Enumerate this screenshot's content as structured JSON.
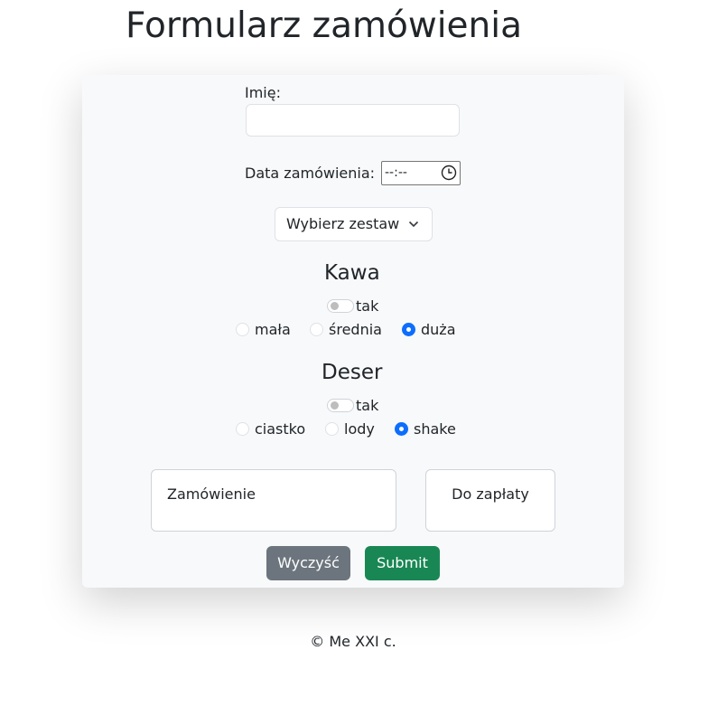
{
  "page": {
    "title": "Formularz zamówienia"
  },
  "form": {
    "name_label": "Imię:",
    "name_value": "",
    "date_label": "Data zamówienia:",
    "time_placeholder": "--:--",
    "set_select": "Wybierz zestaw",
    "coffee": {
      "title": "Kawa",
      "toggle_label": "tak",
      "options": [
        "mała",
        "średnia",
        "duża"
      ],
      "selected": "duża"
    },
    "dessert": {
      "title": "Deser",
      "toggle_label": "tak",
      "options": [
        "ciastko",
        "lody",
        "shake"
      ],
      "selected": "shake"
    },
    "order_box": "Zamówienie",
    "total_box": "Do zapłaty",
    "clear_button": "Wyczyść",
    "submit_button": "Submit"
  },
  "footer": {
    "text": "© Me XXI c."
  },
  "colors": {
    "accent": "#0d6efd",
    "submit": "#198754",
    "clear": "#6c757d",
    "card": "#f8f9fa"
  }
}
